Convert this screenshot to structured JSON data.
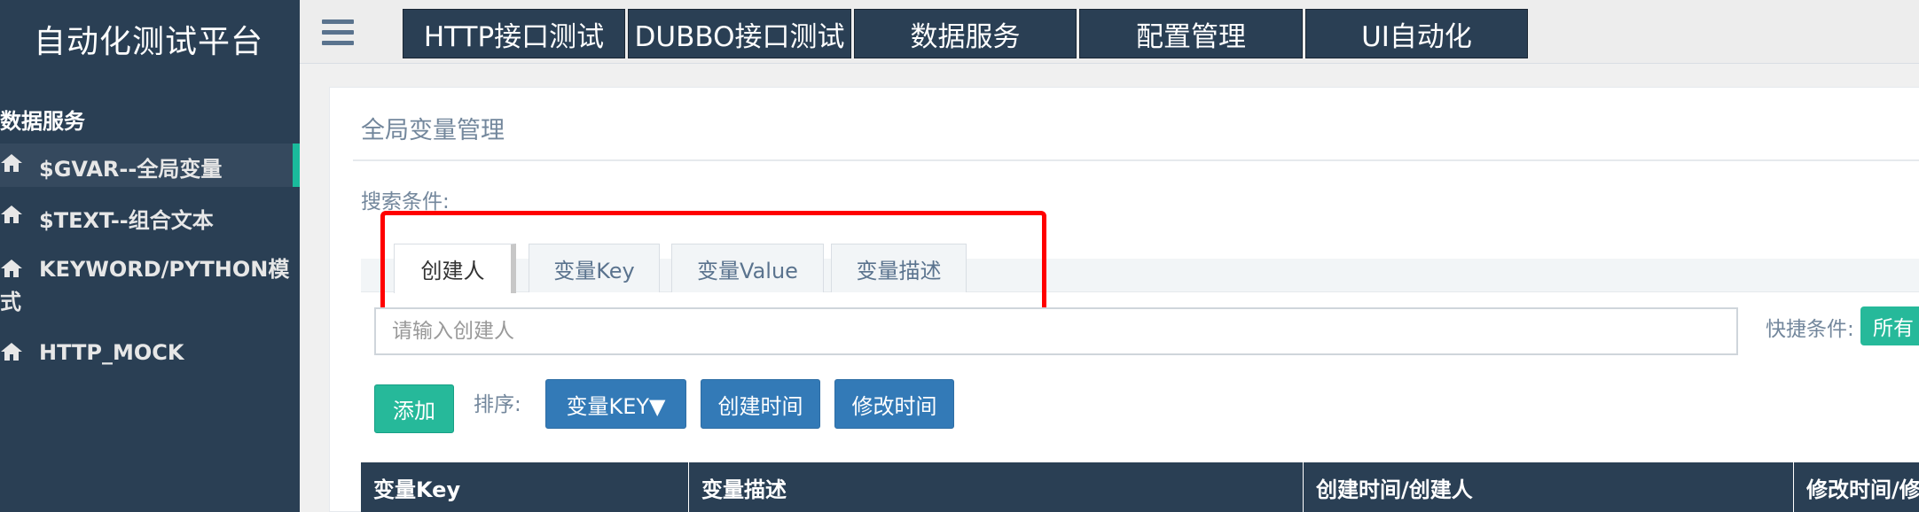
{
  "app": {
    "title": "自动化测试平台"
  },
  "sidebar": {
    "section": "数据服务",
    "items": [
      {
        "label": "$GVAR--全局变量",
        "icon": "home-icon",
        "active": true
      },
      {
        "label": "$TEXT--组合文本",
        "icon": "home-icon",
        "active": false
      },
      {
        "label": "KEYWORD/PYTHON模",
        "label_cont": "式",
        "icon": "home-icon",
        "active": false
      },
      {
        "label": "HTTP_MOCK",
        "icon": "home-icon",
        "active": false
      }
    ]
  },
  "topnav": {
    "menu_icon": "hamburger-icon",
    "items": [
      "HTTP接口测试",
      "DUBBO接口测试",
      "数据服务",
      "配置管理",
      "UI自动化"
    ]
  },
  "panel": {
    "title": "全局变量管理",
    "search_label": "搜索条件:",
    "tabs": [
      "创建人",
      "变量Key",
      "变量Value",
      "变量描述"
    ],
    "active_tab": "创建人",
    "search_placeholder": "请输入创建人",
    "quick_label": "快捷条件:",
    "quick_button": "所有",
    "add_button": "添加",
    "sort_label": "排序:",
    "sort_buttons": [
      "变量KEY▼",
      "创建时间",
      "修改时间"
    ],
    "table_headers": [
      "变量Key",
      "变量描述",
      "创建时间/创建人",
      "修改时间/修"
    ]
  },
  "colors": {
    "sidebar_bg": "#2a3f54",
    "accent_green": "#26b99a",
    "accent_blue": "#337ab7",
    "highlight_red": "#ff0000"
  }
}
